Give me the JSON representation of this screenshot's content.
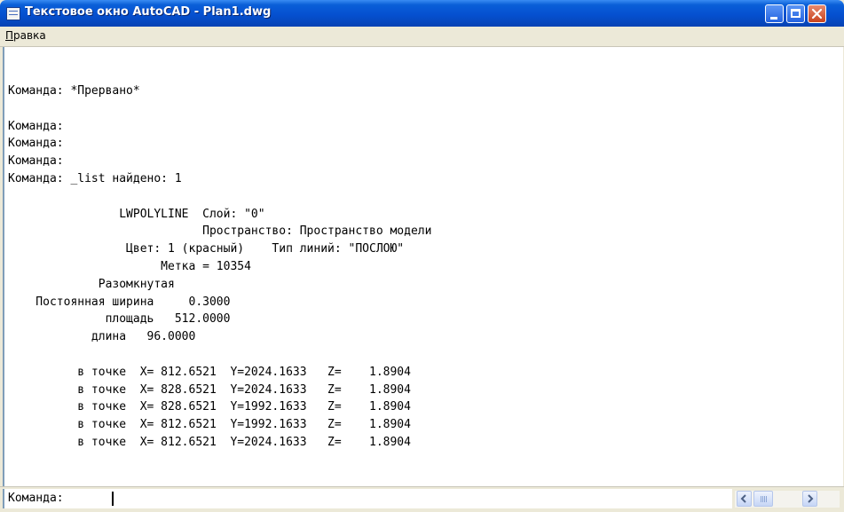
{
  "window": {
    "title": "Текстовое окно AutoCAD - Plan1.dwg",
    "icon": "text-window-icon"
  },
  "menu": {
    "items": [
      {
        "label_accel": "П",
        "label_rest": "равка"
      }
    ]
  },
  "log": {
    "lines": [
      "Команда: *Прервано*",
      "",
      "Команда:",
      "Команда:",
      "Команда:",
      "Команда: _list найдено: 1",
      "",
      "                LWPOLYLINE  Слой: \"0\"",
      "                            Пространство: Пространство модели",
      "                 Цвет: 1 (красный)    Тип линий: \"ПОСЛОЮ\"",
      "                      Метка = 10354",
      "             Разомкнутая",
      "    Постоянная ширина     0.3000",
      "              площадь   512.0000",
      "            длина   96.0000",
      "",
      "          в точке  X= 812.6521  Y=2024.1633   Z=    1.8904",
      "          в точке  X= 828.6521  Y=2024.1633   Z=    1.8904",
      "          в точке  X= 828.6521  Y=1992.1633   Z=    1.8904",
      "          в точке  X= 812.6521  Y=1992.1633   Z=    1.8904",
      "          в точке  X= 812.6521  Y=2024.1633   Z=    1.8904"
    ]
  },
  "prompt": {
    "label": "Команда:",
    "value": ""
  },
  "colors": {
    "title_bar": "#0550d0",
    "window_chrome": "#ece9d8",
    "close_button": "#c8431e"
  },
  "icons": {
    "minimize": "minimize-icon",
    "maximize": "maximize-icon",
    "close": "close-icon",
    "scroll_left": "arrow-left-icon",
    "scroll_right": "arrow-right-icon"
  }
}
